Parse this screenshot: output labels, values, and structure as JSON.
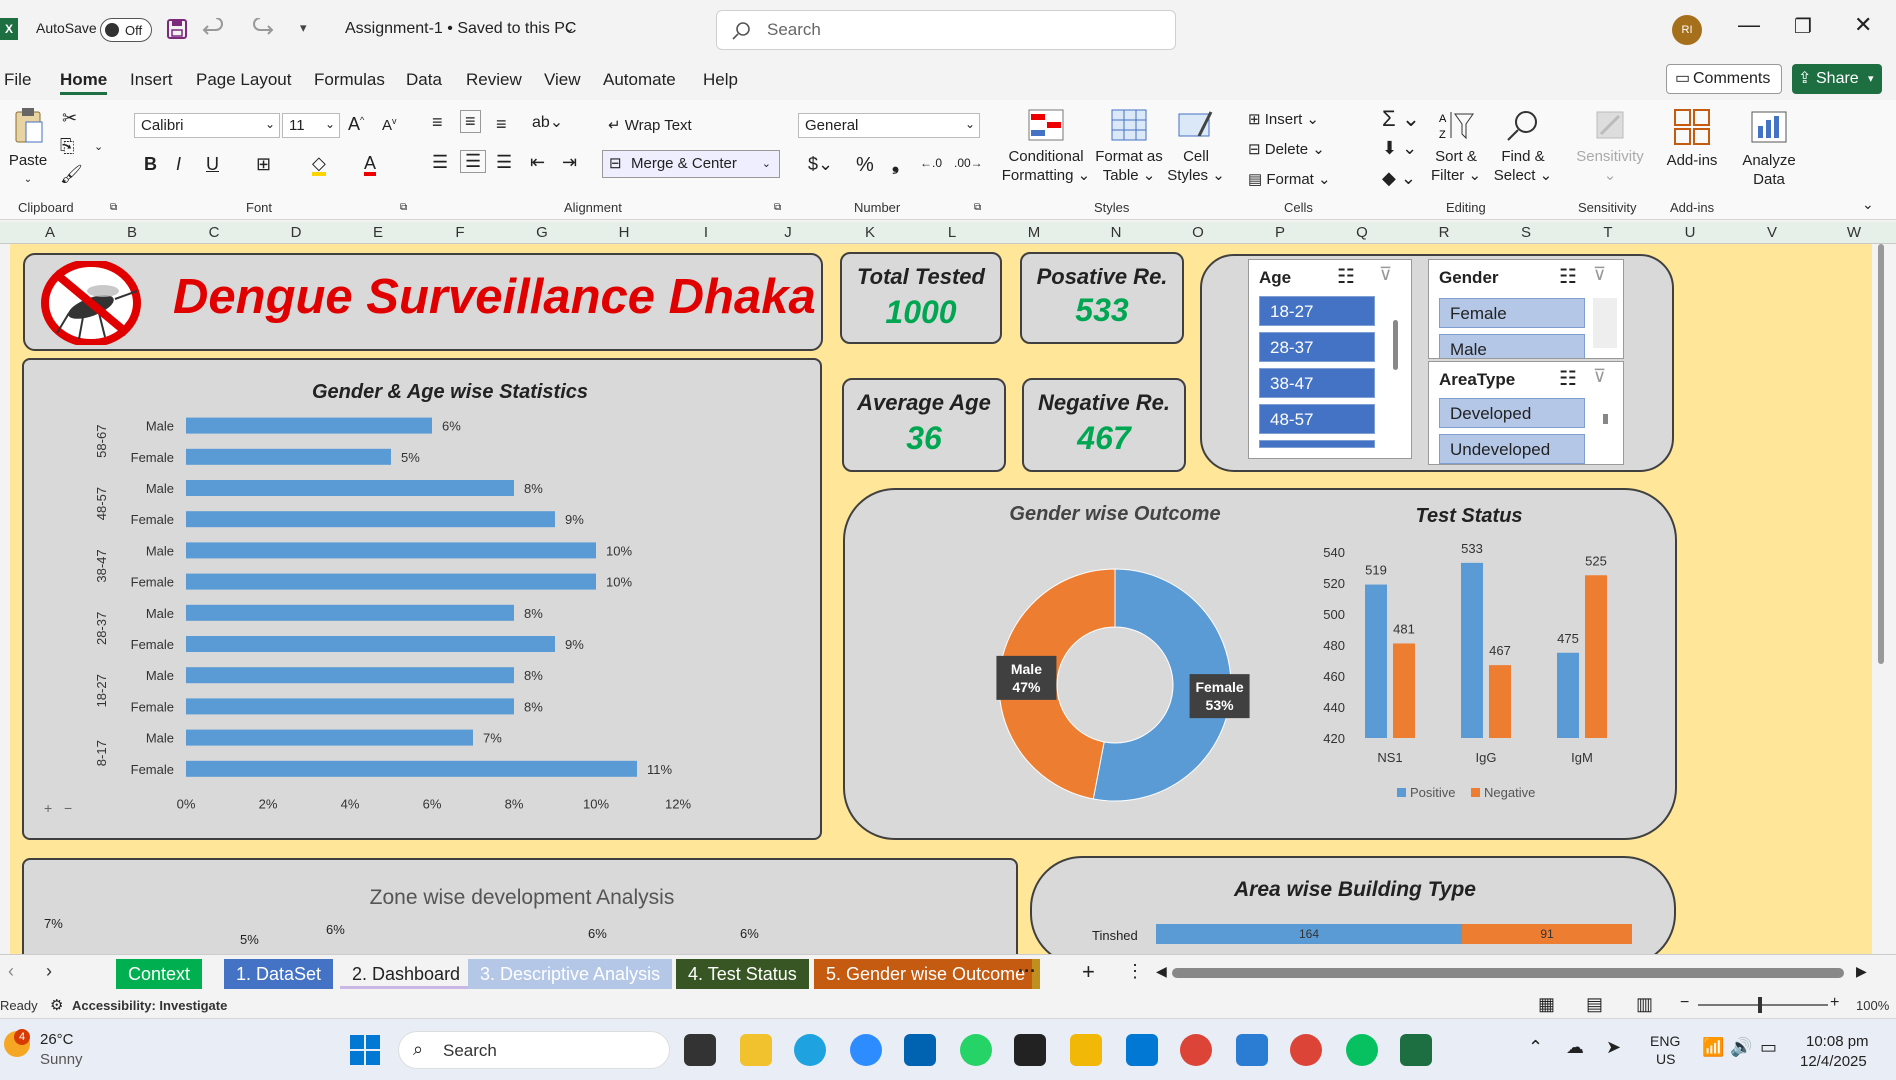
{
  "titlebar": {
    "autosave_label": "AutoSave",
    "autosave_state": "Off",
    "doc_title": "Assignment-1 • Saved to this PC",
    "search_placeholder": "Search",
    "user_initials": "RI"
  },
  "menubar": {
    "items": [
      "File",
      "Home",
      "Insert",
      "Page Layout",
      "Formulas",
      "Data",
      "Review",
      "View",
      "Automate",
      "Help"
    ],
    "comments": "Comments",
    "share": "Share"
  },
  "ribbon": {
    "paste": "Paste",
    "font_name": "Calibri",
    "font_size": "11",
    "wrap_text": "Wrap Text",
    "merge_center": "Merge & Center",
    "number_format": "General",
    "conditional_formatting": [
      "Conditional",
      "Formatting"
    ],
    "format_as_table": [
      "Format as",
      "Table"
    ],
    "cell_styles": [
      "Cell",
      "Styles"
    ],
    "insert": "Insert",
    "delete": "Delete",
    "format": "Format",
    "sort_filter": [
      "Sort &",
      "Filter"
    ],
    "find_select": [
      "Find &",
      "Select"
    ],
    "sensitivity": "Sensitivity",
    "addins": "Add-ins",
    "analyze_data": [
      "Analyze",
      "Data"
    ],
    "groups": [
      "Clipboard",
      "Font",
      "Alignment",
      "Number",
      "Styles",
      "Cells",
      "Editing",
      "Sensitivity",
      "Add-ins"
    ]
  },
  "columns": [
    "A",
    "B",
    "C",
    "D",
    "E",
    "F",
    "G",
    "H",
    "I",
    "J",
    "K",
    "L",
    "M",
    "N",
    "O",
    "P",
    "Q",
    "R",
    "S",
    "T",
    "U",
    "V",
    "W"
  ],
  "dashboard": {
    "title": "Dengue Surveillance Dhaka",
    "kpis": [
      {
        "label": "Total Tested",
        "value": "1000"
      },
      {
        "label": "Posative Re.",
        "value": "533"
      },
      {
        "label": "Average Age",
        "value": "36"
      },
      {
        "label": "Negative Re.",
        "value": "467"
      }
    ],
    "slicers": {
      "age": {
        "header": "Age",
        "items": [
          "18-27",
          "28-37",
          "38-47",
          "48-57"
        ]
      },
      "gender": {
        "header": "Gender",
        "items": [
          "Female",
          "Male"
        ]
      },
      "areatype": {
        "header": "AreaType",
        "items": [
          "Developed",
          "Undeveloped"
        ]
      }
    },
    "zone_title": "Zone wise development Analysis",
    "zone_labels": [
      "7%",
      "6%",
      "5%",
      "6%",
      "6%"
    ],
    "building_title": "Area wise Building Type",
    "building_row": "Tinshed",
    "building_values": [
      "164",
      "91"
    ]
  },
  "chart_data": [
    {
      "type": "bar",
      "orientation": "horizontal",
      "title": "Gender & Age wise Statistics",
      "groups": [
        "58-67",
        "48-57",
        "38-47",
        "28-37",
        "18-27",
        "8-17"
      ],
      "categories": [
        "Male",
        "Female",
        "Male",
        "Female",
        "Male",
        "Female",
        "Male",
        "Female",
        "Male",
        "Female",
        "Male",
        "Female"
      ],
      "values": [
        6,
        5,
        8,
        9,
        10,
        10,
        8,
        9,
        8,
        8,
        7,
        11
      ],
      "data_labels": [
        "6%",
        "5%",
        "8%",
        "9%",
        "10%",
        "10%",
        "8%",
        "9%",
        "8%",
        "8%",
        "7%",
        "11%"
      ],
      "xticks": [
        "0%",
        "2%",
        "4%",
        "6%",
        "8%",
        "10%",
        "12%"
      ],
      "xlim": [
        0,
        12
      ],
      "color": "#5b9bd5"
    },
    {
      "type": "pie",
      "donut": true,
      "title": "Gender wise Outcome",
      "labels": [
        "Female",
        "Male"
      ],
      "values": [
        53,
        47
      ],
      "data_labels": [
        "53%",
        "47%"
      ],
      "colors": [
        "#5b9bd5",
        "#ed7d31"
      ]
    },
    {
      "type": "bar",
      "title": "Test Status",
      "categories": [
        "NS1",
        "IgG",
        "IgM"
      ],
      "series": [
        {
          "name": "Positive",
          "values": [
            519,
            533,
            475
          ],
          "color": "#5b9bd5"
        },
        {
          "name": "Negative",
          "values": [
            481,
            467,
            525
          ],
          "color": "#ed7d31"
        }
      ],
      "yticks": [
        "420",
        "440",
        "460",
        "480",
        "500",
        "520",
        "540"
      ],
      "ylim": [
        420,
        540
      ],
      "legend": "bottom"
    }
  ],
  "sheet_tabs": [
    "Context",
    "1. DataSet",
    "2. Dashboard",
    "3. Descriptive Analysis",
    "4. Test Status",
    "5. Gender wise Outcome"
  ],
  "sheet_tab_colors": [
    "#00b050",
    "#4472c4",
    "#c9b8e6",
    "#b4c7e7",
    "#375623",
    "#c55a11"
  ],
  "status": {
    "ready": "Ready",
    "accessibility": "Accessibility: Investigate",
    "zoom": "100%"
  },
  "taskbar": {
    "weather_temp": "26°C",
    "weather_desc": "Sunny",
    "weather_badge": "4",
    "search": "Search",
    "lang": "ENG",
    "region": "US",
    "time": "10:08 pm",
    "date": "12/4/2025"
  }
}
